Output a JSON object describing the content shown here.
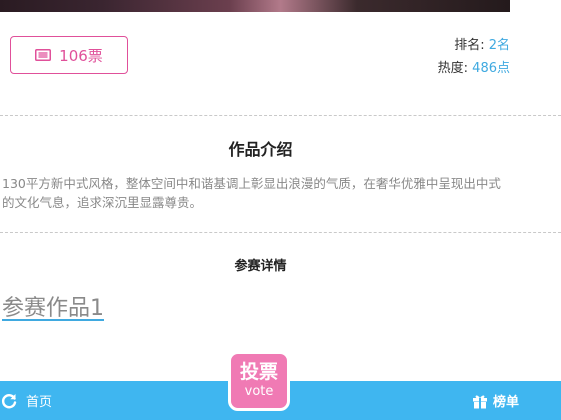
{
  "votes": {
    "label": "106票",
    "icon": "ticket-icon",
    "color": "#e0509a"
  },
  "ranking": {
    "rank_label": "排名:",
    "rank_value": "2名",
    "heat_label": "热度:",
    "heat_value": "486点",
    "value_color": "#3fa9e0"
  },
  "intro": {
    "title": "作品介绍",
    "text": "130平方新中式风格，整体空间中和谐基调上彰显出浪漫的气质，在奢华优雅中呈现出中式的文化气息，追求深沉里显露尊贵。"
  },
  "details": {
    "title": "参赛详情",
    "entry_link": "参赛作品1"
  },
  "vote_button": {
    "cn": "投票",
    "en": "vote",
    "color": "#f07ab4"
  },
  "bottom_nav": {
    "home_label": "首页",
    "home_icon": "refresh-icon",
    "rank_label": "榜单",
    "rank_icon": "gift-icon",
    "bar_color": "#3fb6f0"
  }
}
